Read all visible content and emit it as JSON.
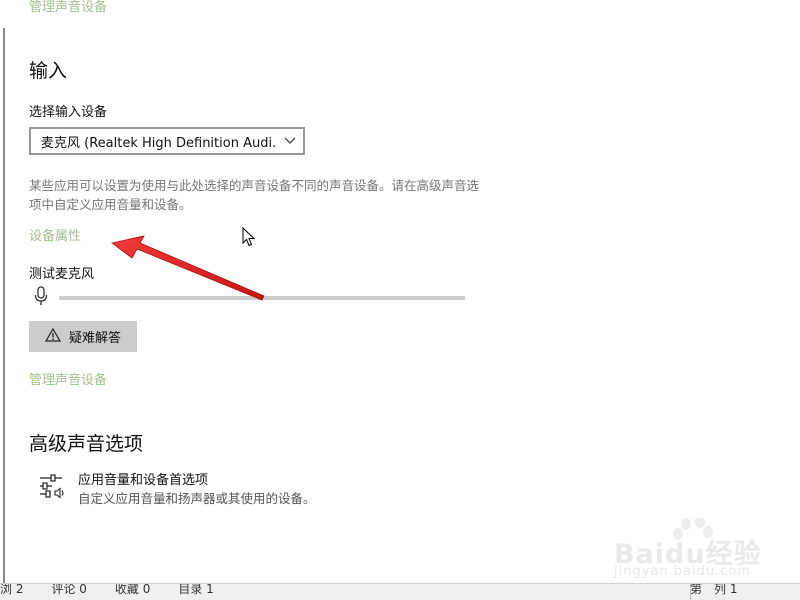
{
  "links": {
    "manage_devices_top": "管理声音设备",
    "device_properties": "设备属性",
    "manage_devices": "管理声音设备"
  },
  "input_section": {
    "title": "输入",
    "select_label": "选择输入设备",
    "selected_device": "麦克风 (Realtek High Definition Audi...",
    "description": "某些应用可以设置为使用与此处选择的声音设备不同的声音设备。请在高级声音选项中自定义应用音量和设备。",
    "test_label": "测试麦克风",
    "mic_level": 0,
    "troubleshoot_label": "疑难解答"
  },
  "advanced_section": {
    "title": "高级声音选项",
    "app_pref_title": "应用音量和设备首选项",
    "app_pref_subtitle": "自定义应用音量和扬声器或其使用的设备。"
  },
  "status_bar": {
    "left_items": [
      "浏 2",
      "评论 0",
      "收藏 0",
      "目录 1"
    ],
    "right_items": [
      "第",
      "列 1"
    ]
  },
  "watermark": {
    "brand": "Baidu经验",
    "sub": "jingyan.baidu.com"
  },
  "colors": {
    "link": "#a3c18f",
    "annotation_arrow": "#e8212a",
    "button_bg": "#cccccc"
  },
  "icons": {
    "dropdown": "chevron-down-icon",
    "mic": "microphone-icon",
    "warning": "warning-icon",
    "app_pref": "sliders-speaker-icon",
    "cursor": "mouse-cursor-icon"
  }
}
